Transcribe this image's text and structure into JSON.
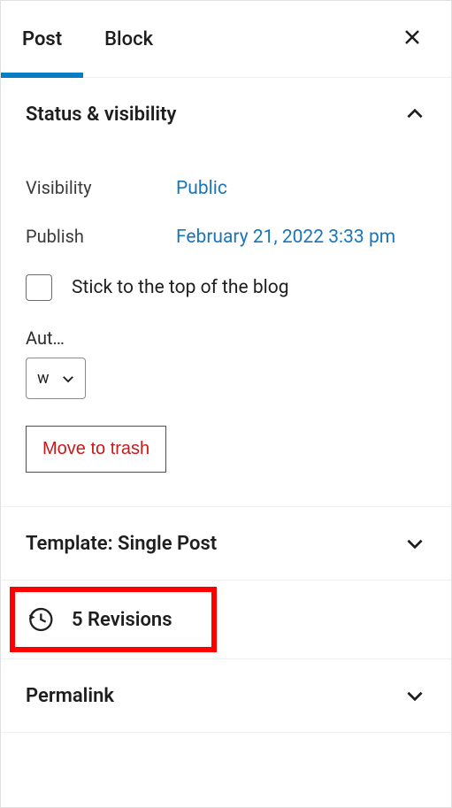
{
  "tabs": {
    "post": "Post",
    "block": "Block"
  },
  "statusPanel": {
    "title": "Status & visibility",
    "visibility": {
      "label": "Visibility",
      "value": "Public"
    },
    "publish": {
      "label": "Publish",
      "value": "February 21, 2022 3:33 pm"
    },
    "sticky": {
      "label": "Stick to the top of the blog"
    },
    "author": {
      "label": "Aut…",
      "value": "w"
    },
    "trash": "Move to trash"
  },
  "templatePanel": {
    "title": "Template: Single Post"
  },
  "revisionsPanel": {
    "title": "5 Revisions"
  },
  "permalinkPanel": {
    "title": "Permalink"
  }
}
